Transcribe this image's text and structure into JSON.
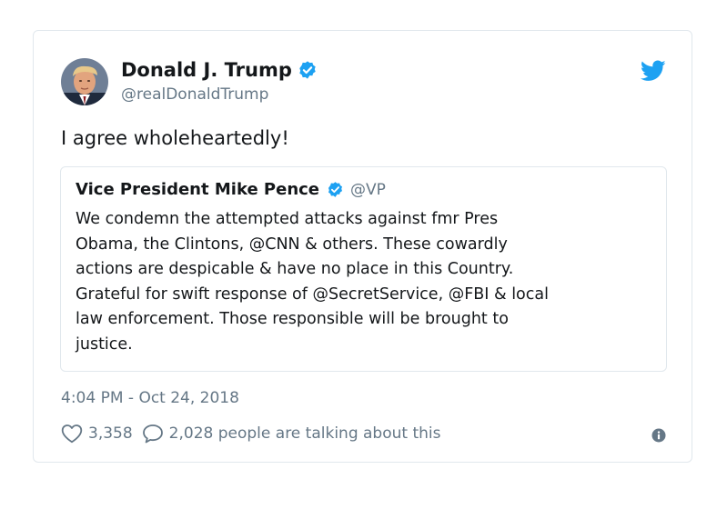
{
  "tweet": {
    "author_name": "Donald J. Trump",
    "author_handle": "@realDonaldTrump",
    "text": "I agree wholeheartedly!",
    "timestamp": "4:04 PM - Oct 24, 2018",
    "likes": "3,358",
    "conversation": "2,028 people are talking about this"
  },
  "quoted_tweet": {
    "author_name": "Vice President Mike Pence",
    "author_handle": "@VP",
    "lines": [
      "We condemn the attempted attacks against fmr Pres",
      "Obama, the Clintons, @CNN & others. These cowardly",
      "actions are despicable & have no place in this Country.",
      "Grateful for swift response of @SecretService, @FBI & local",
      "law enforcement. Those responsible will be brought to",
      "justice."
    ]
  },
  "icons": {
    "verified": "verified-badge-icon",
    "logo": "twitter-bird-icon",
    "like": "heart-icon",
    "reply": "speech-bubble-icon",
    "info": "info-icon"
  },
  "colors": {
    "accent": "#1da1f2",
    "text": "#14171a",
    "secondary": "#657786",
    "border": "#e1e8ed"
  }
}
